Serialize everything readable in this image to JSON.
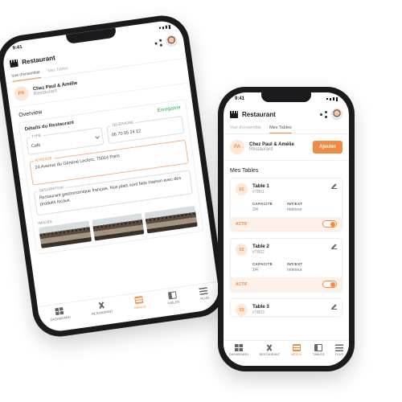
{
  "phone_left": {
    "status_time": "9:41",
    "title": "Restaurant",
    "tabs": [
      "Vue d'ensemble",
      "Mes Tables"
    ],
    "restaurant": {
      "initials": "PA",
      "name": "Chez Paul & Amélie",
      "subtitle": "Restaurant"
    },
    "overview_title": "Overview",
    "details": {
      "title": "Détails du Restaurant",
      "link": "Enregistrer",
      "type_label": "TYPE",
      "type_value": "Café",
      "phone_label": "TÉLÉPHONE",
      "phone_value": "06 70 05 24 12",
      "address_label": "ADRESSE",
      "address_value": "24 Avenue du Général Leclerc, 75014 Paris",
      "description_label": "DESCRIPTION",
      "description_value": "Restaurant gastronomique français. Nos plats sont faits maison avec des produits locaux.",
      "images_label": "IMAGES"
    },
    "nav": [
      "DASHBOARD",
      "RESTAURANT",
      "MENUS",
      "TABLES",
      "PLUS"
    ],
    "nav_active": 2
  },
  "phone_right": {
    "status_time": "9:41",
    "title": "Restaurant",
    "tabs": [
      "Vue d'ensemble",
      "Mes Tables"
    ],
    "restaurant": {
      "initials": "PA",
      "name": "Chez Paul & Amélie",
      "subtitle": "Restaurant",
      "button": "Ajouter"
    },
    "section_title": "Mes Tables",
    "tables": [
      {
        "num": "01",
        "name": "Table 1",
        "code": "#TB01",
        "capacity_label": "CAPACITÉ",
        "capacity": "2/4",
        "location_label": "INT/EXT",
        "location": "Intérieur",
        "active_label": "ACTIF"
      },
      {
        "num": "02",
        "name": "Table 2",
        "code": "#TB02",
        "capacity_label": "CAPACITÉ",
        "capacity": "2/4",
        "location_label": "INT/EXT",
        "location": "Intérieur",
        "active_label": "ACTIF"
      },
      {
        "num": "03",
        "name": "Table 3",
        "code": "#TB03"
      }
    ],
    "nav": [
      "DASHBOARD",
      "RESTAURANT",
      "MENUS",
      "TABLES",
      "PLUS"
    ],
    "nav_active": 2
  },
  "accent_color": "#f28b45"
}
